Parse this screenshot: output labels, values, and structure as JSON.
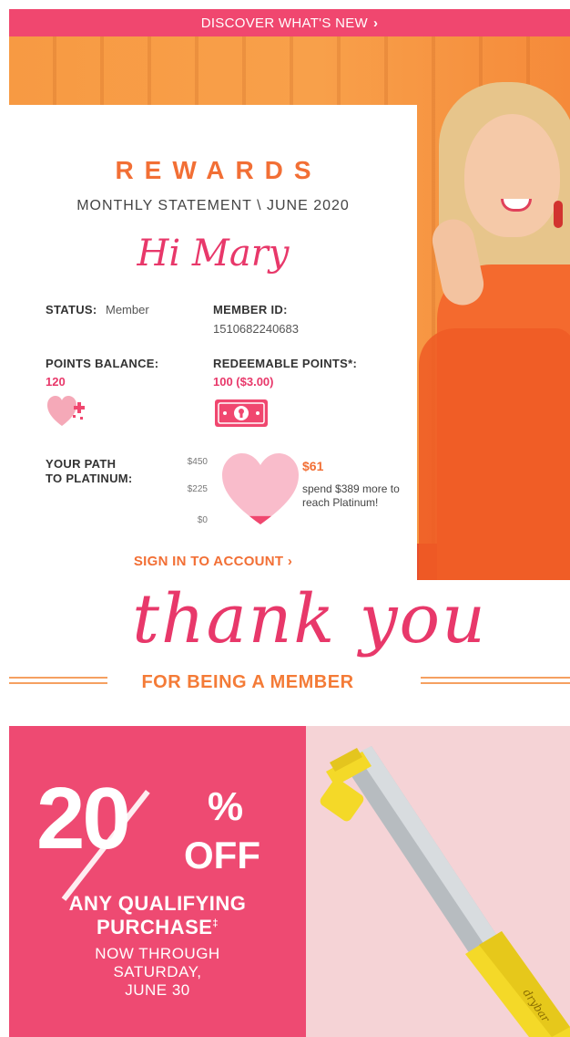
{
  "topbar": {
    "label": "DISCOVER WHAT'S NEW",
    "chevron": "›"
  },
  "card": {
    "brand": "REWARDS",
    "statement": "MONTHLY STATEMENT  \\  JUNE 2020",
    "greeting": "Hi Mary",
    "status_label": "STATUS:",
    "status_value": "Member",
    "member_id_label": "MEMBER ID:",
    "member_id_value": "1510682240683",
    "points_balance_label": "POINTS BALANCE:",
    "points_balance_value": "120",
    "redeemable_label": "REDEEMABLE POINTS*:",
    "redeemable_value": "100 ($3.00)",
    "path_label_1": "YOUR PATH",
    "path_label_2": "TO PLATINUM:",
    "scale": {
      "top": "$450",
      "mid": "$225",
      "bottom": "$0"
    },
    "progress_fraction": 0.136,
    "amount": "$61",
    "spend_text": "spend $389 more to reach Platinum!",
    "signin_label": "SIGN IN TO ACCOUNT",
    "signin_chevron": "›"
  },
  "thanks": {
    "script": "thank you",
    "member_line": "FOR BEING A  MEMBER"
  },
  "promo": {
    "big_number": "20",
    "percent": "%",
    "off": "OFF",
    "line1": "ANY QUALIFYING",
    "line2": "PURCHASE",
    "line2_mark": "‡",
    "line3": "NOW THROUGH",
    "line4": "SATURDAY,",
    "line5": "JUNE 30",
    "product_brand": "drybar"
  },
  "colors": {
    "pink": "#ee4a72",
    "orange": "#f26f35",
    "light_pink": "#f5d3d6",
    "heart": "#f5a9b8",
    "wand_yellow": "#f4d928"
  }
}
